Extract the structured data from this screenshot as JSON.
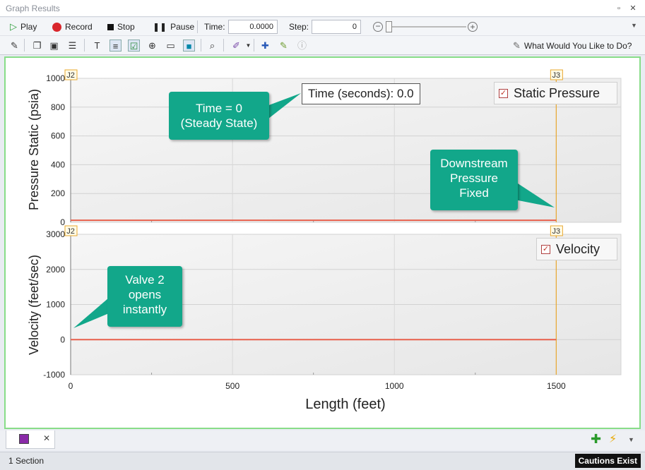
{
  "window": {
    "title": "Graph Results"
  },
  "toolbar": {
    "play_label": "Play",
    "record_label": "Record",
    "stop_label": "Stop",
    "pause_label": "Pause",
    "time_label": "Time:",
    "time_value": "0.0000",
    "step_label": "Step:",
    "step_value": "0",
    "help_label": "What Would You Like to Do?"
  },
  "callouts": {
    "time_zero": "Time = 0\n(Steady State)",
    "time_box": "Time (seconds): 0.0",
    "downstream": "Downstream\nPressure\nFixed",
    "valve": "Valve 2\nopens\ninstantly"
  },
  "chart_data": [
    {
      "type": "line",
      "ylabel": "Pressure Static (psia)",
      "xlabel": "",
      "ylim": [
        0,
        1000
      ],
      "yticks": [
        0,
        200,
        400,
        600,
        800,
        1000
      ],
      "xlim": [
        0,
        1700
      ],
      "legend": [
        "Static Pressure"
      ],
      "legend_position": "top-right",
      "series": [
        {
          "name": "Static Pressure",
          "x": [
            0,
            1500
          ],
          "y": [
            14,
            14
          ],
          "color": "#e8604c"
        }
      ],
      "markers": [
        {
          "label": "J2",
          "x": 0
        },
        {
          "label": "J3",
          "x": 1500
        }
      ],
      "grid": true
    },
    {
      "type": "line",
      "ylabel": "Velocity (feet/sec)",
      "xlabel": "Length (feet)",
      "ylim": [
        -1000,
        3000
      ],
      "yticks": [
        -1000,
        0,
        1000,
        2000,
        3000
      ],
      "xlim": [
        0,
        1700
      ],
      "xticks": [
        0,
        500,
        1000,
        1500
      ],
      "legend": [
        "Velocity"
      ],
      "legend_position": "top-right",
      "series": [
        {
          "name": "Velocity",
          "x": [
            0,
            1500
          ],
          "y": [
            0,
            0
          ],
          "color": "#e8604c"
        }
      ],
      "markers": [
        {
          "label": "J2",
          "x": 0
        },
        {
          "label": "J3",
          "x": 1500
        }
      ],
      "grid": true
    }
  ],
  "tabs": [
    {
      "label": ""
    }
  ],
  "status": {
    "section_count": "1 Section",
    "cautions": "Cautions Exist"
  }
}
